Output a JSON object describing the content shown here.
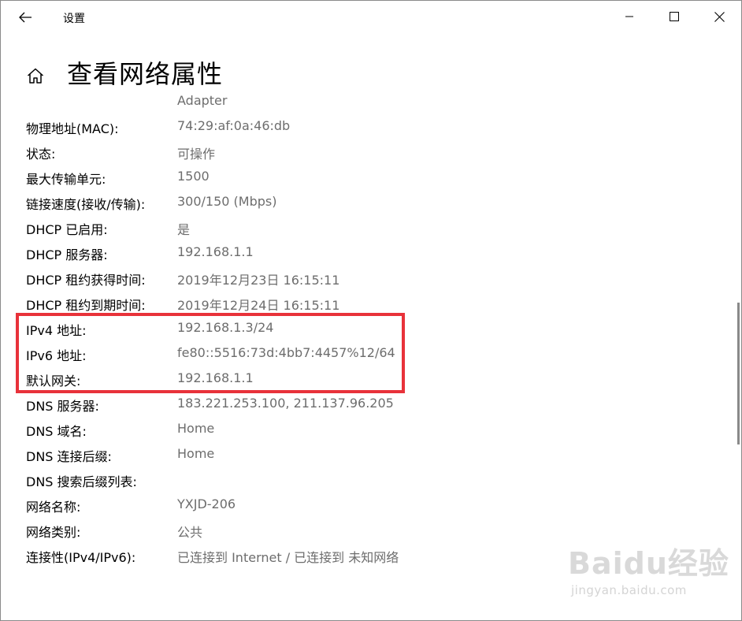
{
  "window": {
    "title": "设置"
  },
  "page": {
    "title": "查看网络属性"
  },
  "properties": [
    {
      "label": "",
      "value": "Adapter"
    },
    {
      "label": "物理地址(MAC):",
      "value": "74:29:af:0a:46:db"
    },
    {
      "label": "状态:",
      "value": "可操作"
    },
    {
      "label": "最大传输单元:",
      "value": "1500"
    },
    {
      "label": "链接速度(接收/传输):",
      "value": "300/150 (Mbps)"
    },
    {
      "label": "DHCP 已启用:",
      "value": "是"
    },
    {
      "label": "DHCP 服务器:",
      "value": "192.168.1.1"
    },
    {
      "label": "DHCP 租约获得时间:",
      "value": "2019年12月23日 16:15:11"
    },
    {
      "label": "DHCP 租约到期时间:",
      "value": "2019年12月24日 16:15:11"
    },
    {
      "label": "IPv4 地址:",
      "value": "192.168.1.3/24"
    },
    {
      "label": "IPv6 地址:",
      "value": "fe80::5516:73d:4bb7:4457%12/64"
    },
    {
      "label": "默认网关:",
      "value": "192.168.1.1"
    },
    {
      "label": "DNS 服务器:",
      "value": "183.221.253.100, 211.137.96.205"
    },
    {
      "label": "DNS 域名:",
      "value": "Home"
    },
    {
      "label": "DNS 连接后缀:",
      "value": "Home"
    },
    {
      "label": "DNS 搜索后缀列表:",
      "value": ""
    },
    {
      "label": "网络名称:",
      "value": "YXJD-206"
    },
    {
      "label": "网络类别:",
      "value": "公共"
    },
    {
      "label": "连接性(IPv4/IPv6):",
      "value": "已连接到 Internet / 已连接到 未知网络"
    }
  ],
  "highlight": {
    "color": "#e8323a"
  },
  "icons": {
    "back": "arrow-left-icon",
    "minimize": "minimize-icon",
    "maximize": "maximize-icon",
    "close": "close-icon",
    "home": "home-icon"
  },
  "watermark": {
    "logo": "Baidu经验",
    "url": "jingyan.baidu.com"
  }
}
